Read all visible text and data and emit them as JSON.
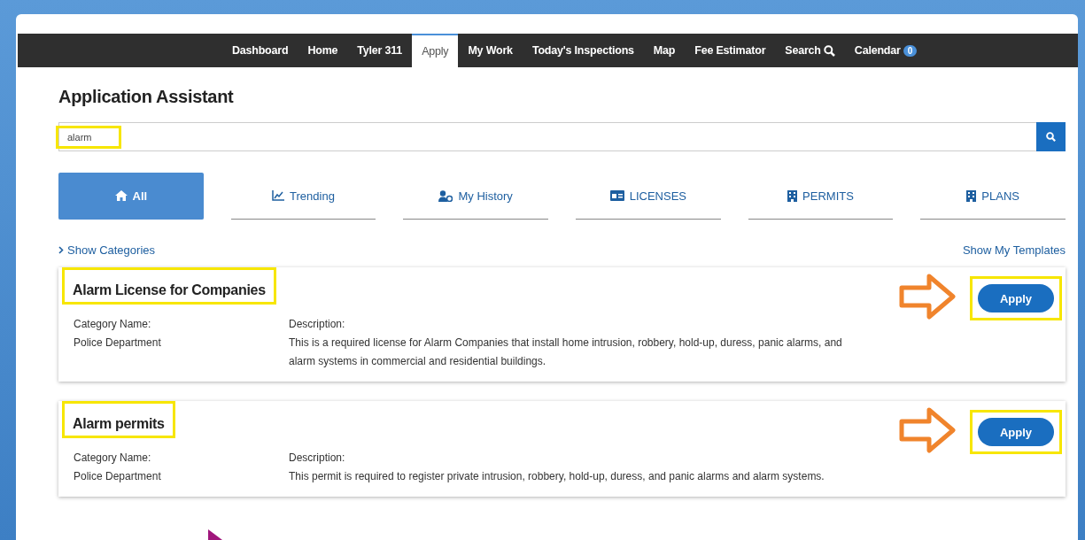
{
  "nav": {
    "items": [
      {
        "label": "Dashboard",
        "kind": "text",
        "selected": false
      },
      {
        "label": "Home",
        "kind": "text",
        "selected": false
      },
      {
        "label": "Tyler 311",
        "kind": "text",
        "selected": false
      },
      {
        "label": "Apply",
        "kind": "text",
        "selected": true
      },
      {
        "label": "My Work",
        "kind": "text",
        "selected": false
      },
      {
        "label": "Today's Inspections",
        "kind": "text",
        "selected": false
      },
      {
        "label": "Map",
        "kind": "text",
        "selected": false
      },
      {
        "label": "Fee Estimator",
        "kind": "text",
        "selected": false
      },
      {
        "label": "Search",
        "kind": "search",
        "selected": false
      },
      {
        "label": "Calendar",
        "kind": "badge",
        "badge": "0",
        "selected": false
      }
    ]
  },
  "page_title": "Application Assistant",
  "search": {
    "value": "alarm",
    "highlighted": true
  },
  "tabs": [
    {
      "label": "All",
      "kind": "home",
      "selected": true
    },
    {
      "label": "Trending",
      "kind": "trending",
      "selected": false
    },
    {
      "label": "My History",
      "kind": "history",
      "selected": false
    },
    {
      "label": "LICENSES",
      "kind": "licenses",
      "selected": false
    },
    {
      "label": "PERMITS",
      "kind": "permits",
      "selected": false
    },
    {
      "label": "PLANS",
      "kind": "plans",
      "selected": false
    }
  ],
  "show_categories": "Show Categories",
  "show_templates": "Show My Templates",
  "results": [
    {
      "title": "Alarm License for Companies",
      "highlighted": true,
      "pointer_arrow": true,
      "category_label": "Category Name:",
      "category": "Police Department",
      "description_label": "Description:",
      "description": "This is a required license for Alarm Companies that install home intrusion, robbery, hold-up, duress, panic alarms, and alarm systems in commercial and residential buildings.",
      "button": "Apply"
    },
    {
      "title": "Alarm permits",
      "highlighted": true,
      "pointer_arrow": true,
      "category_label": "Category Name:",
      "category": "Police Department",
      "description_label": "Description:",
      "description": "This permit is required to register private intrusion, robbery, hold-up, duress, and panic alarms and alarm systems.",
      "button": "Apply"
    }
  ]
}
